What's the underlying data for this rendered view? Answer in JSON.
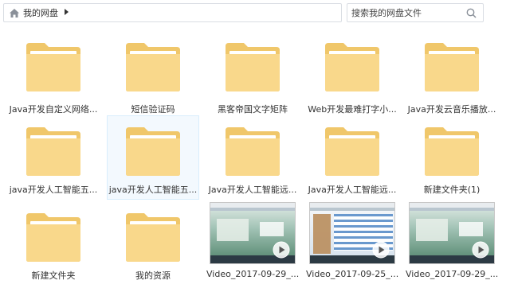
{
  "breadcrumb": {
    "root_label": "我的网盘"
  },
  "search": {
    "placeholder": "搜索我的网盘文件"
  },
  "colors": {
    "folder_back": "#f0c76a",
    "folder_front": "#f9d88b",
    "selection_bg": "#f3f9fe"
  },
  "files": [
    {
      "name": "Java开发自定义网络...",
      "type": "folder"
    },
    {
      "name": "短信验证码",
      "type": "folder"
    },
    {
      "name": "黑客帝国文字矩阵",
      "type": "folder"
    },
    {
      "name": "Web开发最难打字小...",
      "type": "folder"
    },
    {
      "name": "Java开发云音乐播放...",
      "type": "folder"
    },
    {
      "name": "java开发人工智能五...",
      "type": "folder"
    },
    {
      "name": "java开发人工智能五...",
      "type": "folder",
      "selected": true
    },
    {
      "name": "Java开发人工智能远...",
      "type": "folder"
    },
    {
      "name": "Java开发人工智能远...",
      "type": "folder"
    },
    {
      "name": "新建文件夹(1)",
      "type": "folder"
    },
    {
      "name": "新建文件夹",
      "type": "folder"
    },
    {
      "name": "我的资源",
      "type": "folder"
    },
    {
      "name": "Video_2017-09-29_...",
      "type": "video",
      "icon": "play-icon"
    },
    {
      "name": "Video_2017-09-25_...",
      "type": "video",
      "icon": "play-icon"
    },
    {
      "name": "Video_2017-09-29_...",
      "type": "video",
      "icon": "play-icon"
    }
  ]
}
